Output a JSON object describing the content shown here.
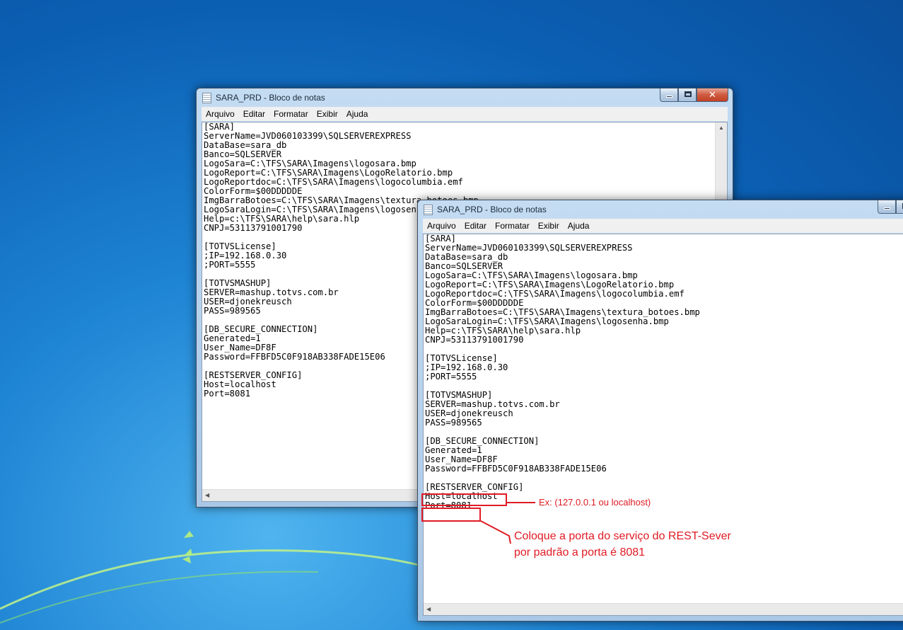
{
  "colors": {
    "annotation": "#e01b24",
    "desktop": "#1e84d4"
  },
  "window_back": {
    "title": "SARA_PRD - Bloco de notas",
    "menu": [
      "Arquivo",
      "Editar",
      "Formatar",
      "Exibir",
      "Ajuda"
    ],
    "text": "[SARA]\nServerName=JVD060103399\\SQLSERVEREXPRESS\nDataBase=sara_db\nBanco=SQLSERVER\nLogoSara=C:\\TFS\\SARA\\Imagens\\logosara.bmp\nLogoReport=C:\\TFS\\SARA\\Imagens\\LogoRelatorio.bmp\nLogoReportdoc=C:\\TFS\\SARA\\Imagens\\logocolumbia.emf\nColorForm=$00DDDDDE\nImgBarraBotoes=C:\\TFS\\SARA\\Imagens\\textura_botoes.bmp\nLogoSaraLogin=C:\\TFS\\SARA\\Imagens\\logosenha.bmp\nHelp=c:\\TFS\\SARA\\help\\sara.hlp\nCNPJ=53113791001790\n\n[TOTVSLicense]\n;IP=192.168.0.30\n;PORT=5555\n\n[TOTVSMASHUP]\nSERVER=mashup.totvs.com.br\nUSER=djonekreusch\nPASS=989565\n\n[DB_SECURE_CONNECTION]\nGenerated=1\nUser_Name=DF8F\nPassword=FFBFD5C0F918AB338FADE15E06\n\n[RESTSERVER_CONFIG]\nHost=localhost\nPort=8081"
  },
  "window_front": {
    "title": "SARA_PRD - Bloco de notas",
    "menu": [
      "Arquivo",
      "Editar",
      "Formatar",
      "Exibir",
      "Ajuda"
    ],
    "text": "[SARA]\nServerName=JVD060103399\\SQLSERVEREXPRESS\nDataBase=sara_db\nBanco=SQLSERVER\nLogoSara=C:\\TFS\\SARA\\Imagens\\logosara.bmp\nLogoReport=C:\\TFS\\SARA\\Imagens\\LogoRelatorio.bmp\nLogoReportdoc=C:\\TFS\\SARA\\Imagens\\logocolumbia.emf\nColorForm=$00DDDDDE\nImgBarraBotoes=C:\\TFS\\SARA\\Imagens\\textura_botoes.bmp\nLogoSaraLogin=C:\\TFS\\SARA\\Imagens\\logosenha.bmp\nHelp=c:\\TFS\\SARA\\help\\sara.hlp\nCNPJ=53113791001790\n\n[TOTVSLicense]\n;IP=192.168.0.30\n;PORT=5555\n\n[TOTVSMASHUP]\nSERVER=mashup.totvs.com.br\nUSER=djonekreusch\nPASS=989565\n\n[DB_SECURE_CONNECTION]\nGenerated=1\nUser_Name=DF8F\nPassword=FFBFD5C0F918AB338FADE15E06\n\n[RESTSERVER_CONFIG]\nHost=localhost\nPort=8081"
  },
  "annotations": {
    "host_note": "Ex: (127.0.0.1 ou localhost)",
    "port_note_line1": "Coloque a porta do serviço do REST-Sever",
    "port_note_line2": "por padrão a porta é 8081"
  }
}
